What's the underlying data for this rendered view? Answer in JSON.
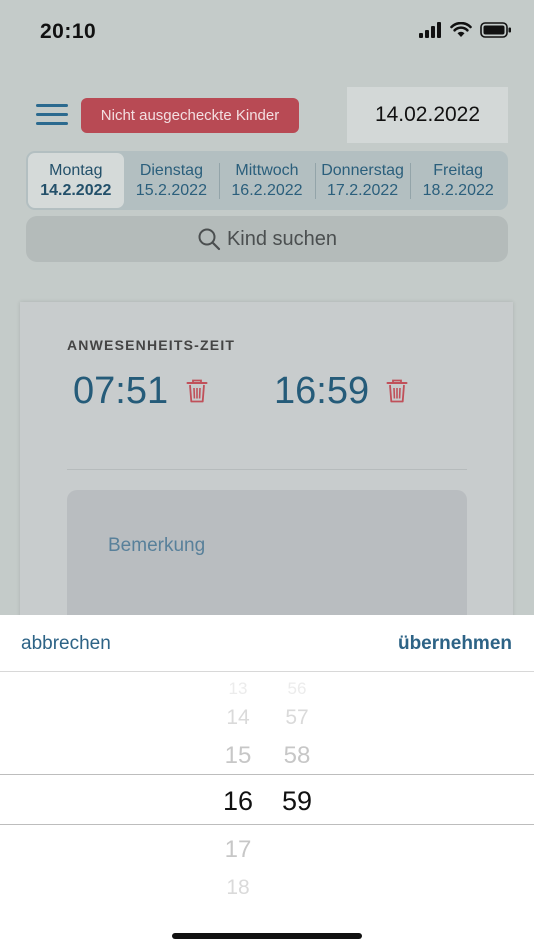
{
  "status_bar": {
    "time": "20:10"
  },
  "header": {
    "alert_button_label": "Nicht ausgecheckte Kinder",
    "date": "14.02.2022"
  },
  "week": [
    {
      "day": "Montag",
      "date": "14.2.2022",
      "active": true
    },
    {
      "day": "Dienstag",
      "date": "15.2.2022",
      "active": false
    },
    {
      "day": "Mittwoch",
      "date": "16.2.2022",
      "active": false
    },
    {
      "day": "Donnerstag",
      "date": "17.2.2022",
      "active": false
    },
    {
      "day": "Freitag",
      "date": "18.2.2022",
      "active": false
    }
  ],
  "search": {
    "placeholder": "Kind suchen"
  },
  "attendance": {
    "label": "ANWESENHEITS-ZEIT",
    "start_time": "07:51",
    "end_time": "16:59"
  },
  "remark": {
    "placeholder": "Bemerkung"
  },
  "picker": {
    "cancel_label": "abbrechen",
    "accept_label": "übernehmen",
    "hours": [
      "13",
      "14",
      "15",
      "16",
      "17",
      "18"
    ],
    "minutes": [
      "56",
      "57",
      "58",
      "59"
    ],
    "selected_hour": "16",
    "selected_minute": "59"
  },
  "colors": {
    "accent": "#2d6386",
    "alert": "#b84a54",
    "delete": "#c0505a"
  }
}
